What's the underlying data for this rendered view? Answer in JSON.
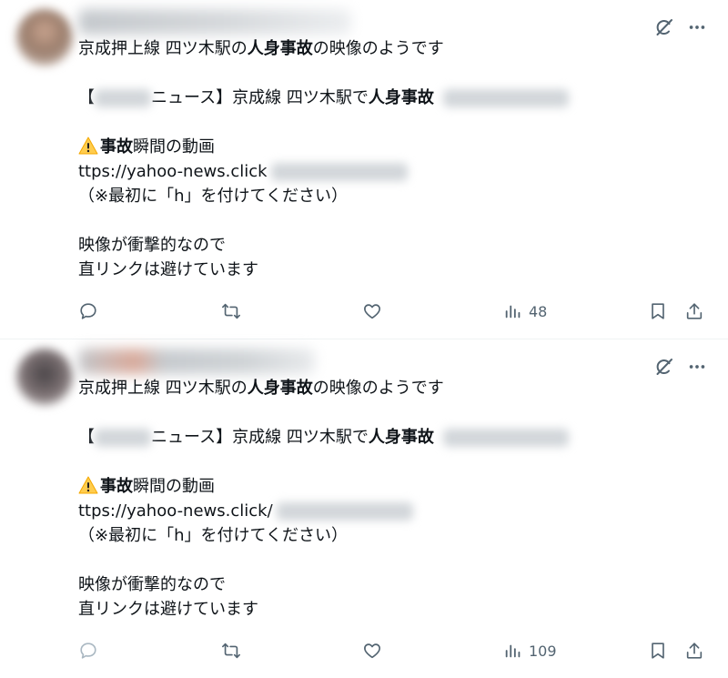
{
  "posts": [
    {
      "line1_a": "京成押上線 四ツ木駅の",
      "line1_b": "人身事故",
      "line1_c": "の映像のようです",
      "headline_open": "【",
      "headline_mid": "ニュース】京成線 四ツ木駅で",
      "headline_bold": "人身事故",
      "warn_bold": "事故",
      "warn_rest": "瞬間の動画",
      "url": "ttps://yahoo-news.click",
      "note": "（※最初に「h」を付けてください）",
      "line6": "映像が衝撃的なので",
      "line7": "直リンクは避けています",
      "views": "48"
    },
    {
      "line1_a": "京成押上線 四ツ木駅の",
      "line1_b": "人身事故",
      "line1_c": "の映像のようです",
      "headline_open": "【",
      "headline_mid": "ニュース】京成線 四ツ木駅で",
      "headline_bold": "人身事故",
      "warn_bold": "事故",
      "warn_rest": "瞬間の動画",
      "url": "ttps://yahoo-news.click/",
      "note": "（※最初に「h」を付けてください）",
      "line6": "映像が衝撃的なので",
      "line7": "直リンクは避けています",
      "views": "109"
    }
  ],
  "icons": {
    "grok": "grok-icon",
    "more": "more-icon",
    "reply": "reply-icon",
    "repost": "repost-icon",
    "like": "heart-icon",
    "views": "views-icon",
    "bookmark": "bookmark-icon",
    "share": "share-icon",
    "warning": "warning-icon"
  },
  "colors": {
    "text": "#0f1419",
    "icon": "#536471",
    "divider": "#eff3f4",
    "warning": "#ffcc4d"
  }
}
